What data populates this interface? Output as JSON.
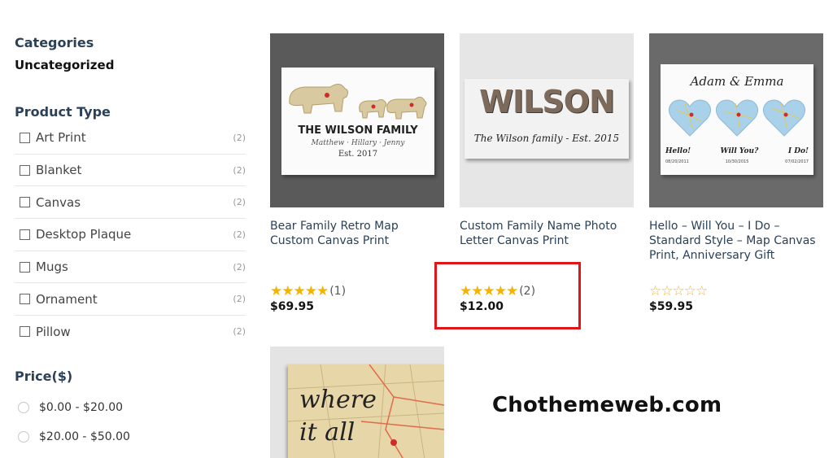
{
  "sidebar": {
    "categories_title": "Categories",
    "category_item": "Uncategorized",
    "product_type_title": "Product Type",
    "filters": [
      {
        "label": "Art Print",
        "count": "(2)"
      },
      {
        "label": "Blanket",
        "count": "(2)"
      },
      {
        "label": "Canvas",
        "count": "(2)"
      },
      {
        "label": "Desktop Plaque",
        "count": "(2)"
      },
      {
        "label": "Mugs",
        "count": "(2)"
      },
      {
        "label": "Ornament",
        "count": "(2)"
      },
      {
        "label": "Pillow",
        "count": "(2)"
      }
    ],
    "price_title": "Price($)",
    "price_ranges": [
      "$0.00 - $20.00",
      "$20.00 - $50.00"
    ]
  },
  "products": [
    {
      "title": "Bear Family Retro Map Custom Canvas Print",
      "stars": "★★★★★",
      "rating_count": "(1)",
      "price": "$69.95",
      "image": {
        "heading": "THE WILSON FAMILY",
        "names": "Matthew · Hillary · Jenny",
        "est": "Est. 2017"
      }
    },
    {
      "title": "Custom Family Name Photo Letter Canvas Print",
      "stars": "★★★★★",
      "rating_count": "(2)",
      "price": "$12.00",
      "image": {
        "word": "WILSON",
        "caption": "The Wilson family - Est. 2015"
      }
    },
    {
      "title": "Hello – Will You – I Do – Standard Style – Map Canvas Print, Anniversary Gift",
      "stars": "☆☆☆☆☆",
      "rating_count": "",
      "price": "$59.95",
      "image": {
        "heading": "Adam & Emma",
        "captions": [
          "Hello!",
          "Will You?",
          "I Do!"
        ],
        "dates": [
          "08/20/2011",
          "10/30/2015",
          "07/02/2017"
        ]
      }
    },
    {
      "image": {
        "line1": "where",
        "line2": "it all"
      }
    }
  ],
  "watermark": "Chothemeweb.com",
  "colors": {
    "star": "#f5b400",
    "highlight": "#e0151a",
    "heading": "#2b4158"
  }
}
